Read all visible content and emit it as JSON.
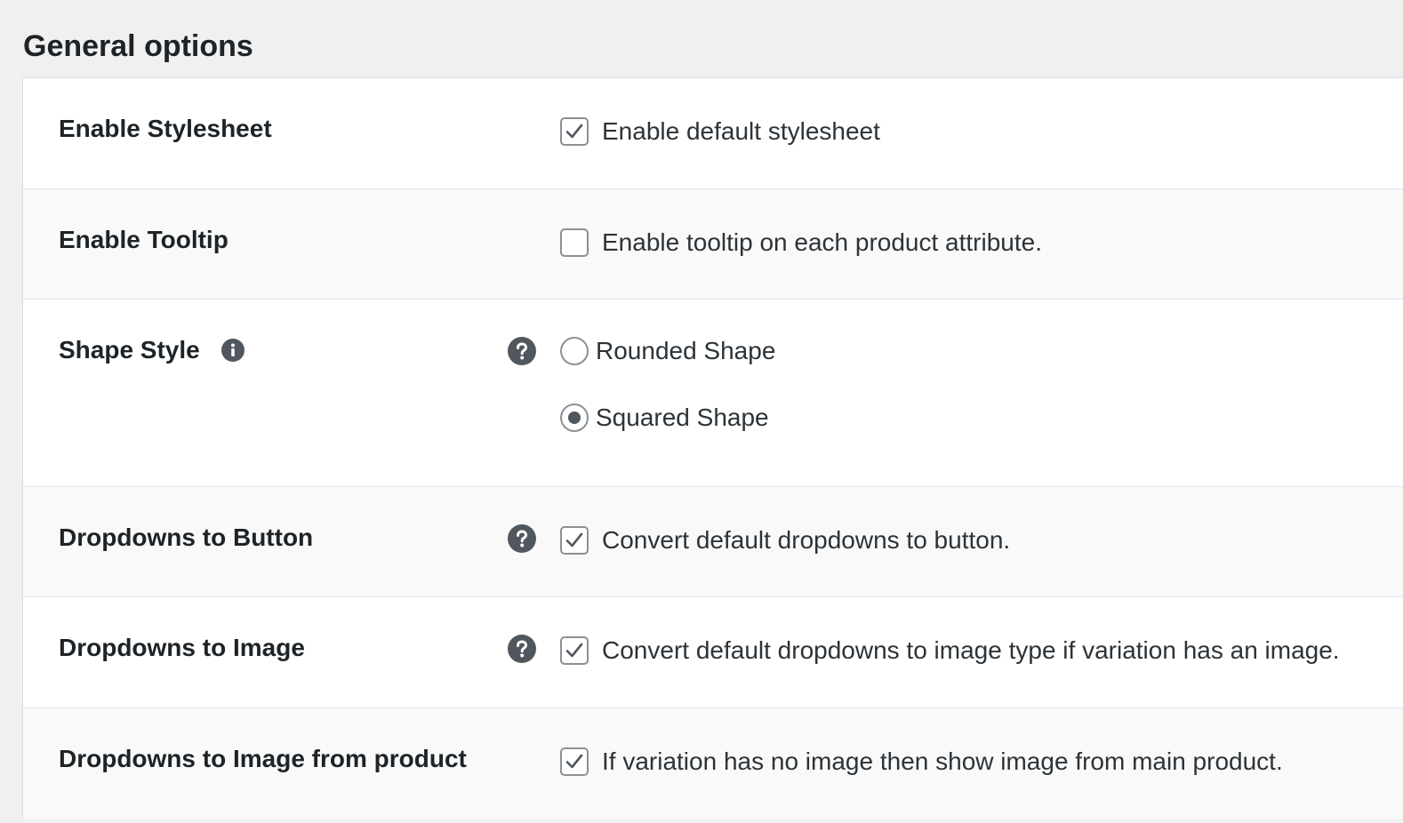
{
  "page": {
    "title": "General options"
  },
  "colors": {
    "background": "#f0f0f1",
    "panel": "#ffffff",
    "row_alt": "#f9f9f9",
    "text": "#1d2327",
    "icon": "#50575e",
    "checkbox_border": "#8c8f94"
  },
  "settings": [
    {
      "label": "Enable Stylesheet",
      "control": "checkbox",
      "checked": true,
      "description": "Enable default stylesheet"
    },
    {
      "label": "Enable Tooltip",
      "control": "checkbox",
      "checked": false,
      "description": "Enable tooltip on each product attribute."
    },
    {
      "label": "Shape Style",
      "info_icon": "info-icon",
      "help_icon": "help-icon",
      "control": "radio",
      "options": [
        {
          "label": "Rounded Shape",
          "checked": false
        },
        {
          "label": "Squared Shape",
          "checked": true
        }
      ]
    },
    {
      "label": "Dropdowns to Button",
      "help_icon": "help-icon",
      "control": "checkbox",
      "checked": true,
      "description": "Convert default dropdowns to button."
    },
    {
      "label": "Dropdowns to Image",
      "help_icon": "help-icon",
      "control": "checkbox",
      "checked": true,
      "description": "Convert default dropdowns to image type if variation has an image."
    },
    {
      "label": "Dropdowns to Image from product",
      "control": "checkbox",
      "checked": true,
      "description": "If variation has no image then show image from main product."
    }
  ]
}
